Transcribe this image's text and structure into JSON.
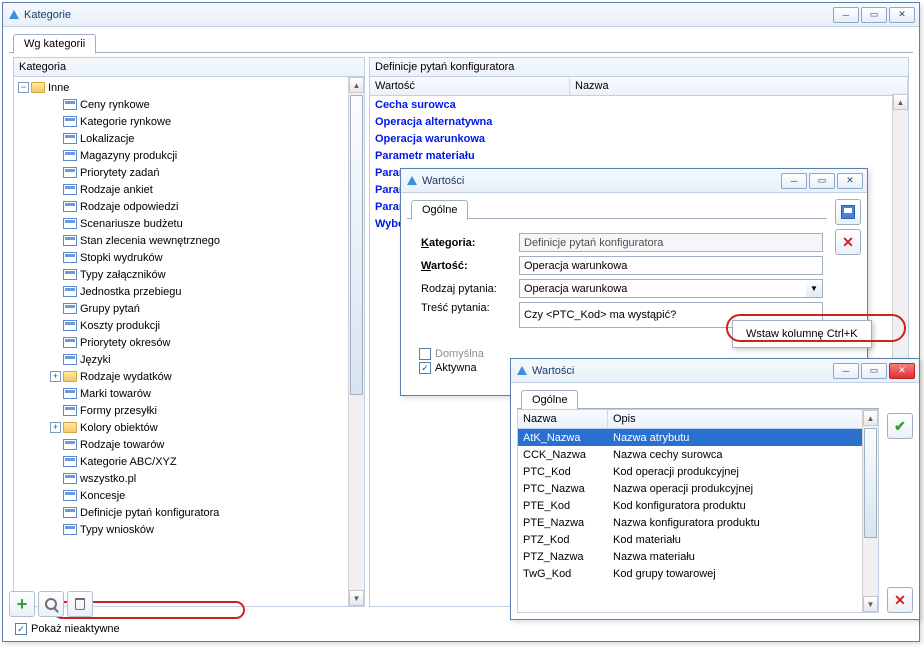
{
  "mainWindow": {
    "title": "Kategorie",
    "tab": "Wg kategorii",
    "left": {
      "header": "Kategoria",
      "rootExp": "−",
      "root": "Inne",
      "items": [
        {
          "label": "Ceny rynkowe",
          "exp": null,
          "folder": false
        },
        {
          "label": "Kategorie rynkowe",
          "exp": null,
          "folder": false
        },
        {
          "label": "Lokalizacje",
          "exp": null,
          "folder": false
        },
        {
          "label": "Magazyny produkcji",
          "exp": null,
          "folder": false
        },
        {
          "label": "Priorytety zadań",
          "exp": null,
          "folder": false
        },
        {
          "label": "Rodzaje ankiet",
          "exp": null,
          "folder": false
        },
        {
          "label": "Rodzaje odpowiedzi",
          "exp": null,
          "folder": false
        },
        {
          "label": "Scenariusze budżetu",
          "exp": null,
          "folder": false
        },
        {
          "label": "Stan zlecenia wewnętrznego",
          "exp": null,
          "folder": false
        },
        {
          "label": "Stopki wydruków",
          "exp": null,
          "folder": false
        },
        {
          "label": "Typy załączników",
          "exp": null,
          "folder": false
        },
        {
          "label": "Jednostka przebiegu",
          "exp": null,
          "folder": false
        },
        {
          "label": "Grupy pytań",
          "exp": null,
          "folder": false
        },
        {
          "label": "Koszty produkcji",
          "exp": null,
          "folder": false
        },
        {
          "label": "Priorytety okresów",
          "exp": null,
          "folder": false
        },
        {
          "label": "Języki",
          "exp": null,
          "folder": false
        },
        {
          "label": "Rodzaje wydatków",
          "exp": "+",
          "folder": true
        },
        {
          "label": "Marki towarów",
          "exp": null,
          "folder": false
        },
        {
          "label": "Formy przesyłki",
          "exp": null,
          "folder": false
        },
        {
          "label": "Kolory obiektów",
          "exp": "+",
          "folder": true
        },
        {
          "label": "Rodzaje towarów",
          "exp": null,
          "folder": false
        },
        {
          "label": "Kategorie ABC/XYZ",
          "exp": null,
          "folder": false
        },
        {
          "label": "wszystko.pl",
          "exp": null,
          "folder": false
        },
        {
          "label": "Koncesje",
          "exp": null,
          "folder": false
        },
        {
          "label": "Definicje pytań konfiguratora",
          "exp": null,
          "folder": false
        },
        {
          "label": "Typy wniosków",
          "exp": null,
          "folder": false
        }
      ]
    },
    "right": {
      "header": "Definicje pytań konfiguratora",
      "col1": "Wartość",
      "col2": "Nazwa",
      "rows": [
        "Cecha surowca",
        "Operacja alternatywna",
        "Operacja warunkowa",
        "Parametr materiału",
        "Parametr operacji",
        "Parametr surowca",
        "Parametr technologii",
        "Wybór surowca"
      ]
    },
    "showInactive": "Pokaż nieaktywne",
    "showInactiveChecked": "✓"
  },
  "dlg1": {
    "title": "Wartości",
    "tab": "Ogólne",
    "labels": {
      "kategoria": "Kategoria:",
      "wartosc": "Wartość:",
      "rodzaj": "Rodzaj pytania:",
      "tresc": "Treść pytania:",
      "domyslna": "Domyślna",
      "aktywna": "Aktywna"
    },
    "values": {
      "kategoria": "Definicje pytań konfiguratora",
      "wartosc": "Operacja warunkowa",
      "rodzaj": "Operacja warunkowa",
      "tresc": "Czy <PTC_Kod> ma wystąpić?"
    },
    "aktywnaChecked": "✓",
    "contextMenu": "Wstaw kolumnę  Ctrl+K"
  },
  "dlg2": {
    "title": "Wartości",
    "tab": "Ogólne",
    "col1": "Nazwa",
    "col2": "Opis",
    "rows": [
      {
        "n": "AtK_Nazwa",
        "o": "Nazwa atrybutu",
        "sel": true
      },
      {
        "n": "CCK_Nazwa",
        "o": "Nazwa cechy surowca"
      },
      {
        "n": "PTC_Kod",
        "o": "Kod operacji produkcyjnej"
      },
      {
        "n": "PTC_Nazwa",
        "o": "Nazwa operacji produkcyjnej"
      },
      {
        "n": "PTE_Kod",
        "o": "Kod konfiguratora produktu"
      },
      {
        "n": "PTE_Nazwa",
        "o": "Nazwa konfiguratora produktu"
      },
      {
        "n": "PTZ_Kod",
        "o": "Kod materiału"
      },
      {
        "n": "PTZ_Nazwa",
        "o": "Nazwa materiału"
      },
      {
        "n": "TwG_Kod",
        "o": "Kod grupy towarowej"
      }
    ]
  }
}
